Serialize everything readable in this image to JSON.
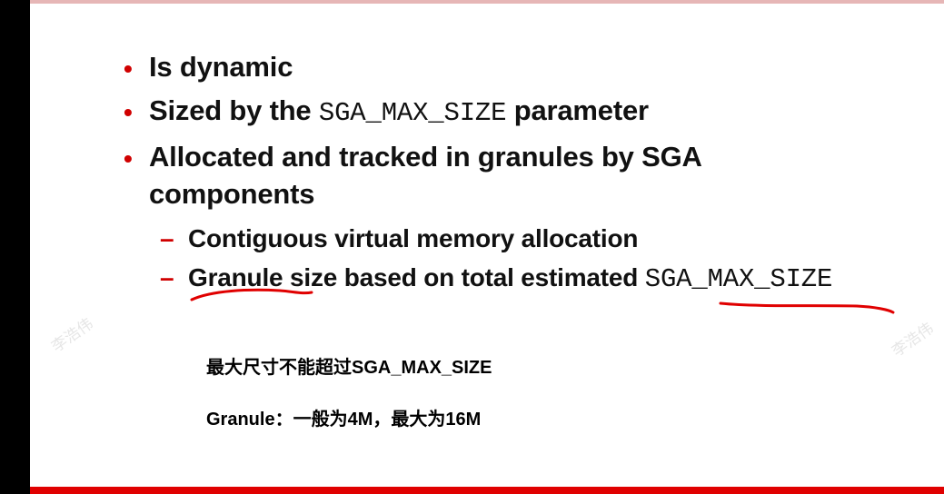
{
  "bullets": [
    {
      "text": "Is dynamic"
    },
    {
      "pre": "Sized by the ",
      "code": "SGA_MAX_SIZE",
      "post": " parameter"
    },
    {
      "line1": "Allocated and tracked in granules by SGA",
      "line2": "components"
    }
  ],
  "sub_bullets": [
    {
      "text": "Contiguous virtual memory allocation"
    },
    {
      "pre": "Granule size based on total estimated ",
      "code": "SGA_MAX_SIZE"
    }
  ],
  "notes": {
    "line1": "最大尺寸不能超过SGA_MAX_SIZE",
    "line2": "Granule：一般为4M，最大为16M"
  },
  "watermark": "李浩伟",
  "colors": {
    "accent": "#d00000",
    "annotation_ink": "#e00000"
  }
}
